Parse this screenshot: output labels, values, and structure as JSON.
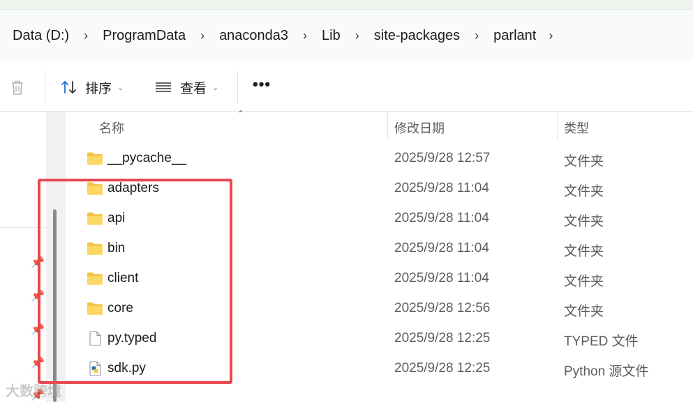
{
  "breadcrumb": {
    "items": [
      "Data (D:)",
      "ProgramData",
      "anaconda3",
      "Lib",
      "site-packages",
      "parlant"
    ],
    "separator": "›"
  },
  "toolbar": {
    "sort_label": "排序",
    "view_label": "查看",
    "more_label": "•••"
  },
  "columns": {
    "name": "名称",
    "date": "修改日期",
    "type": "类型"
  },
  "files": [
    {
      "name": "__pycache__",
      "date": "2025/9/28 12:57",
      "type": "文件夹",
      "icon": "folder-icon"
    },
    {
      "name": "adapters",
      "date": "2025/9/28 11:04",
      "type": "文件夹",
      "icon": "folder-icon"
    },
    {
      "name": "api",
      "date": "2025/9/28 11:04",
      "type": "文件夹",
      "icon": "folder-icon"
    },
    {
      "name": "bin",
      "date": "2025/9/28 11:04",
      "type": "文件夹",
      "icon": "folder-icon"
    },
    {
      "name": "client",
      "date": "2025/9/28 11:04",
      "type": "文件夹",
      "icon": "folder-icon"
    },
    {
      "name": "core",
      "date": "2025/9/28 12:56",
      "type": "文件夹",
      "icon": "folder-icon"
    },
    {
      "name": "py.typed",
      "date": "2025/9/28 12:25",
      "type": "TYPED 文件",
      "icon": "file-icon"
    },
    {
      "name": "sdk.py",
      "date": "2025/9/28 12:25",
      "type": "Python 源文件",
      "icon": "python-file-icon"
    }
  ],
  "watermark": "大数跨境",
  "colors": {
    "highlight": "#e8484f",
    "folder": "#f7c948"
  }
}
